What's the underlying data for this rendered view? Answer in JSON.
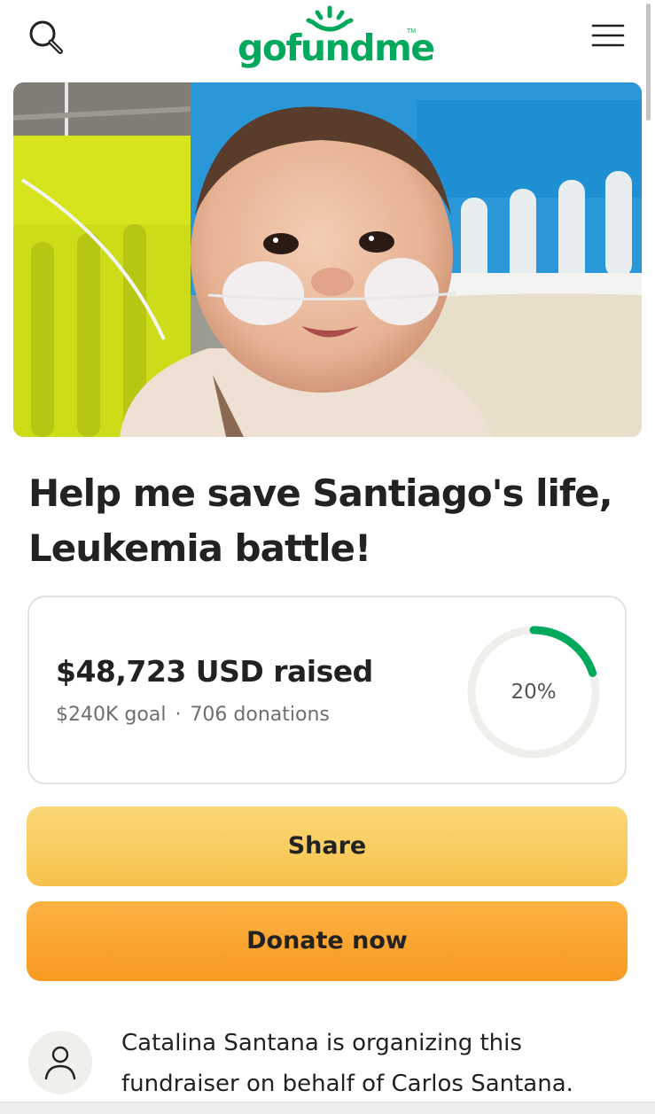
{
  "header": {
    "logo_text": "gofundme",
    "logo_tm": "TM",
    "search_icon": "search-icon",
    "menu_icon": "hamburger-menu-icon"
  },
  "hero": {
    "image_subject": "baby-in-hospital-crib-photo"
  },
  "campaign": {
    "title": "Help me save Santiago's life, Leukemia battle!"
  },
  "progress": {
    "raised": "$48,723 USD raised",
    "goal": "$240K goal",
    "separator": "·",
    "donations": "706 donations",
    "percent_label": "20%",
    "percent_value": 0.2
  },
  "actions": {
    "share_label": "Share",
    "donate_label": "Donate now"
  },
  "organizer": {
    "text": "Catalina Santana is organizing this fundraiser on behalf of Carlos Santana.",
    "avatar_icon": "user-icon"
  },
  "colors": {
    "brand_green": "#02a95c",
    "share_yellow": "#f6c24c",
    "donate_orange": "#f89a20",
    "ring_track": "#f1efeb"
  }
}
